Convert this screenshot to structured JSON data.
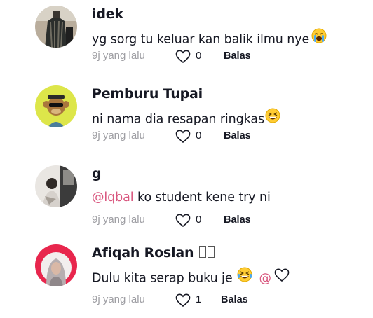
{
  "comments": [
    {
      "username": "idek",
      "text": "yg sorg tu keluar kan balik ilmu nye",
      "emoji": "loudly-crying-face-icon",
      "time": "9j yang lalu",
      "likes": "0",
      "reply": "Balas"
    },
    {
      "username": "Pemburu Tupai",
      "text": "ni nama dia resapan ringkas",
      "emoji": "grinning-squinting-face-icon",
      "time": "9j yang lalu",
      "likes": "0",
      "reply": "Balas"
    },
    {
      "username": "g",
      "mention": "@lqbal",
      "text": " ko student kene try ni",
      "time": "9j yang lalu",
      "likes": "0",
      "reply": "Balas"
    },
    {
      "username": "Afiqah Roslan",
      "text": "Dulu kita serap buku je",
      "emoji": "grinning-squinting-face-icon",
      "mention": "@",
      "time": "9j yang lalu",
      "likes": "1",
      "reply": "Balas"
    }
  ],
  "colors": {
    "mention": "#d9577f",
    "secondary_text": "#9e9ea3",
    "primary_text": "#161823"
  }
}
